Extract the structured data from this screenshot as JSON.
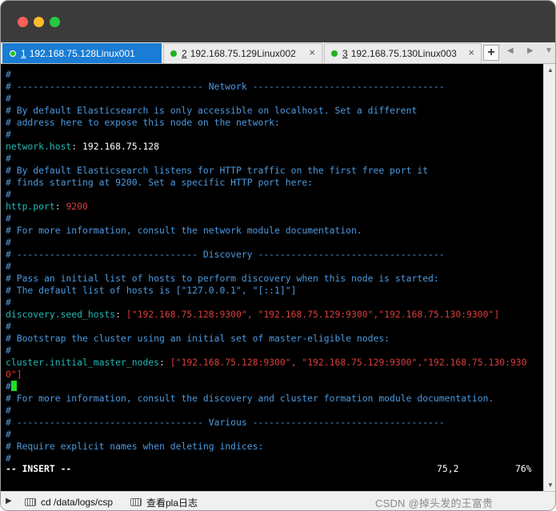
{
  "tabs": [
    {
      "num": "1",
      "title": "192.168.75.128Linux001",
      "active": true
    },
    {
      "num": "2",
      "title": "192.168.75.129Linux002",
      "active": false
    },
    {
      "num": "3",
      "title": "192.168.75.130Linux003",
      "active": false
    }
  ],
  "tab_close_glyph": "×",
  "add_tab_glyph": "+",
  "terminal": {
    "lines": [
      {
        "seg": [
          {
            "c": "cm",
            "t": "#"
          }
        ]
      },
      {
        "seg": [
          {
            "c": "cm",
            "t": "# ---------------------------------- Network -----------------------------------"
          }
        ]
      },
      {
        "seg": [
          {
            "c": "cm",
            "t": "#"
          }
        ]
      },
      {
        "seg": [
          {
            "c": "cm",
            "t": "# By default Elasticsearch is only accessible on localhost. Set a different"
          }
        ]
      },
      {
        "seg": [
          {
            "c": "cm",
            "t": "# address here to expose this node on the network:"
          }
        ]
      },
      {
        "seg": [
          {
            "c": "cm",
            "t": "#"
          }
        ]
      },
      {
        "seg": [
          {
            "c": "key",
            "t": "network.host"
          },
          {
            "c": "punct",
            "t": ": "
          },
          {
            "c": "val",
            "t": "192.168.75.128"
          }
        ]
      },
      {
        "seg": [
          {
            "c": "cm",
            "t": "#"
          }
        ]
      },
      {
        "seg": [
          {
            "c": "cm",
            "t": "# By default Elasticsearch listens for HTTP traffic on the first free port it"
          }
        ]
      },
      {
        "seg": [
          {
            "c": "cm",
            "t": "# finds starting at 9200. Set a specific HTTP port here:"
          }
        ]
      },
      {
        "seg": [
          {
            "c": "cm",
            "t": "#"
          }
        ]
      },
      {
        "seg": [
          {
            "c": "key",
            "t": "http.port"
          },
          {
            "c": "punct",
            "t": ": "
          },
          {
            "c": "num",
            "t": "9200"
          }
        ]
      },
      {
        "seg": [
          {
            "c": "cm",
            "t": "#"
          }
        ]
      },
      {
        "seg": [
          {
            "c": "cm",
            "t": "# For more information, consult the network module documentation."
          }
        ]
      },
      {
        "seg": [
          {
            "c": "cm",
            "t": "#"
          }
        ]
      },
      {
        "seg": [
          {
            "c": "cm",
            "t": "# --------------------------------- Discovery ----------------------------------"
          }
        ]
      },
      {
        "seg": [
          {
            "c": "cm",
            "t": "#"
          }
        ]
      },
      {
        "seg": [
          {
            "c": "cm",
            "t": "# Pass an initial list of hosts to perform discovery when this node is started:"
          }
        ]
      },
      {
        "seg": [
          {
            "c": "cm",
            "t": "# The default list of hosts is [\"127.0.0.1\", \"[::1]\"]"
          }
        ]
      },
      {
        "seg": [
          {
            "c": "cm",
            "t": "#"
          }
        ]
      },
      {
        "seg": [
          {
            "c": "key",
            "t": "discovery.seed_hosts"
          },
          {
            "c": "punct",
            "t": ": "
          },
          {
            "c": "str",
            "t": "[\"192.168.75.128:9300\", \"192.168.75.129:9300\",\"192.168.75.130:9300\"]"
          }
        ]
      },
      {
        "seg": [
          {
            "c": "cm",
            "t": "#"
          }
        ]
      },
      {
        "seg": [
          {
            "c": "cm",
            "t": "# Bootstrap the cluster using an initial set of master-eligible nodes:"
          }
        ]
      },
      {
        "seg": [
          {
            "c": "cm",
            "t": "#"
          }
        ]
      },
      {
        "seg": [
          {
            "c": "key",
            "t": "cluster.initial_master_nodes"
          },
          {
            "c": "punct",
            "t": ": "
          },
          {
            "c": "str",
            "t": "[\"192.168.75.128:9300\", \"192.168.75.129:9300\",\"192.168.75.130:930"
          }
        ]
      },
      {
        "seg": [
          {
            "c": "str",
            "t": "0\"]"
          }
        ]
      },
      {
        "seg": [
          {
            "c": "cm",
            "t": "#"
          }
        ],
        "cursor": true
      },
      {
        "seg": [
          {
            "c": "cm",
            "t": "# For more information, consult the discovery and cluster formation module documentation."
          }
        ]
      },
      {
        "seg": [
          {
            "c": "cm",
            "t": "#"
          }
        ]
      },
      {
        "seg": [
          {
            "c": "cm",
            "t": "# ---------------------------------- Various -----------------------------------"
          }
        ]
      },
      {
        "seg": [
          {
            "c": "cm",
            "t": "#"
          }
        ]
      },
      {
        "seg": [
          {
            "c": "cm",
            "t": "# Require explicit names when deleting indices:"
          }
        ]
      },
      {
        "seg": [
          {
            "c": "cm",
            "t": "#"
          }
        ]
      }
    ],
    "status_mode": "-- INSERT --",
    "cursor_pos": "75,2",
    "scroll_percent": "76%"
  },
  "bottom": {
    "cmd1": "cd /data/logs/csp",
    "cmd2": "查看pla日志",
    "watermark": "CSDN @掉头发的王富贵"
  },
  "colors": {
    "comment": "#4b9ae0",
    "key": "#25b8b8",
    "string": "#d93d3d",
    "active_tab": "#1a7cd4",
    "cursor": "#1ee01e"
  }
}
